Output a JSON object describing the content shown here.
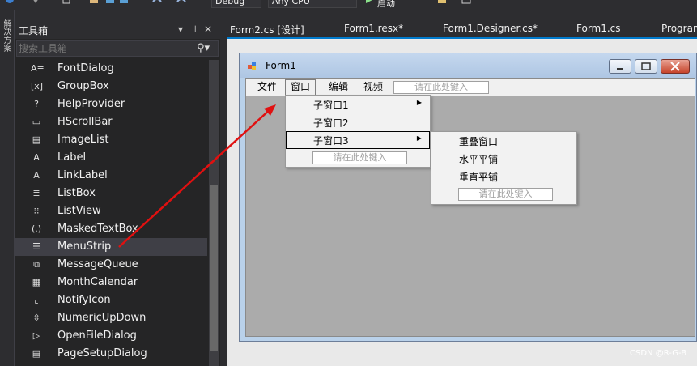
{
  "toolbar": {
    "config_combo": "Debug",
    "platform_combo": "Any CPU",
    "start_label": "启动"
  },
  "left_strip": {
    "label": "解决方案"
  },
  "toolbox": {
    "title": "工具箱",
    "search_placeholder": "搜索工具箱",
    "items": [
      {
        "label": "FontDialog",
        "icon": "font-dialog-icon",
        "glyph": "A≡"
      },
      {
        "label": "GroupBox",
        "icon": "groupbox-icon",
        "glyph": "[x]"
      },
      {
        "label": "HelpProvider",
        "icon": "help-icon",
        "glyph": "?"
      },
      {
        "label": "HScrollBar",
        "icon": "hscrollbar-icon",
        "glyph": "▭"
      },
      {
        "label": "ImageList",
        "icon": "imagelist-icon",
        "glyph": "▤"
      },
      {
        "label": "Label",
        "icon": "label-icon",
        "glyph": "A"
      },
      {
        "label": "LinkLabel",
        "icon": "linklabel-icon",
        "glyph": "A"
      },
      {
        "label": "ListBox",
        "icon": "listbox-icon",
        "glyph": "≣"
      },
      {
        "label": "ListView",
        "icon": "listview-icon",
        "glyph": "⁝⁝"
      },
      {
        "label": "MaskedTextBox",
        "icon": "maskedtextbox-icon",
        "glyph": "(.)"
      },
      {
        "label": "MenuStrip",
        "icon": "menustrip-icon",
        "glyph": "☰"
      },
      {
        "label": "MessageQueue",
        "icon": "messagequeue-icon",
        "glyph": "⧉"
      },
      {
        "label": "MonthCalendar",
        "icon": "monthcalendar-icon",
        "glyph": "▦"
      },
      {
        "label": "NotifyIcon",
        "icon": "notifyicon-icon",
        "glyph": "⌞"
      },
      {
        "label": "NumericUpDown",
        "icon": "numericupdown-icon",
        "glyph": "⇳"
      },
      {
        "label": "OpenFileDialog",
        "icon": "openfiledialog-icon",
        "glyph": "▷"
      },
      {
        "label": "PageSetupDialog",
        "icon": "pagesetup-icon",
        "glyph": "▤"
      }
    ],
    "selected": "MenuStrip"
  },
  "doc_tabs": [
    {
      "label": "Form2.cs [设计]"
    },
    {
      "label": "Form1.resx*"
    },
    {
      "label": "Form1.Designer.cs*"
    },
    {
      "label": "Form1.cs"
    },
    {
      "label": "Program"
    }
  ],
  "form": {
    "title": "Form1",
    "menu": [
      {
        "label": "文件"
      },
      {
        "label": "窗口"
      },
      {
        "label": "编辑"
      },
      {
        "label": "视频"
      }
    ],
    "type_here": "请在此处键入",
    "window_dropdown": [
      {
        "label": "子窗口1",
        "has_submenu": true
      },
      {
        "label": "子窗口2",
        "has_submenu": false
      },
      {
        "label": "子窗口3",
        "has_submenu": true
      }
    ],
    "sub3_dropdown": [
      {
        "label": "重叠窗口"
      },
      {
        "label": "水平平铺"
      },
      {
        "label": "垂直平铺"
      }
    ]
  },
  "watermark": "CSDN @R-G-B",
  "colors": {
    "accent": "#007acc",
    "arrow": "#e01010",
    "ide_bg": "#2d2d30",
    "form_client": "#ababab"
  }
}
